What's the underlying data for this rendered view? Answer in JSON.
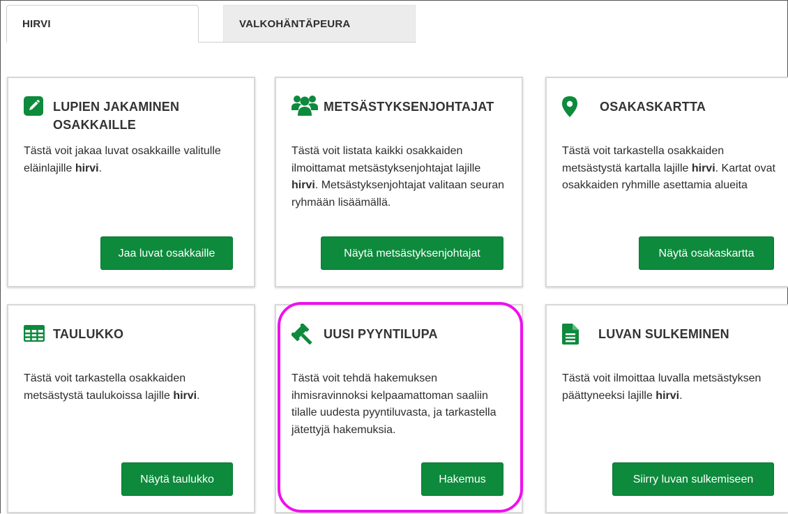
{
  "tabs": [
    {
      "label": "HIRVI",
      "active": true
    },
    {
      "label": "VALKOHÄNTÄPEURA",
      "active": false
    }
  ],
  "colors": {
    "accent_green": "#0d8a3c",
    "highlight_magenta": "#ee10ee"
  },
  "cards": [
    {
      "icon": "pencil-icon",
      "title": "LUPIEN JAKAMINEN OSAKKAILLE",
      "desc_pre": "Tästä voit jakaa luvat osakkaille valitulle eläinlajille ",
      "desc_bold": "hirvi",
      "desc_post": ".",
      "button": "Jaa luvat osakkaille"
    },
    {
      "icon": "users-icon",
      "title": "METSÄSTYKSENJOHTAJAT",
      "desc_pre": "Tästä voit listata kaikki osakkaiden ilmoittamat metsästyksenjohtajat lajille ",
      "desc_bold": "hirvi",
      "desc_post": ". Metsästyksenjohtajat valitaan seuran ryhmään lisäämällä.",
      "button": "Näytä metsästyksenjohtajat"
    },
    {
      "icon": "map-marker-icon",
      "title": "OSAKASKARTTA",
      "desc_pre": "Tästä voit tarkastella osakkaiden metsästystä kartalla lajille ",
      "desc_bold": "hirvi",
      "desc_post": ". Kartat ovat osakkaiden ryhmille asettamia alueita",
      "button": "Näytä osakaskartta"
    },
    {
      "icon": "table-icon",
      "title": "TAULUKKO",
      "desc_pre": "Tästä voit tarkastella osakkaiden metsästystä taulukoissa lajille ",
      "desc_bold": "hirvi",
      "desc_post": ".",
      "button": "Näytä taulukko"
    },
    {
      "icon": "gavel-icon",
      "title": "UUSI PYYNTILUPA",
      "desc_pre": "Tästä voit tehdä hakemuksen ihmisravinnoksi kelpaamattoman saaliin tilalle uudesta pyyntiluvasta, ja tarkastella jätettyjä hakemuksia.",
      "desc_bold": "",
      "desc_post": "",
      "button": "Hakemus"
    },
    {
      "icon": "document-icon",
      "title": "LUVAN SULKEMINEN",
      "desc_pre": "Tästä voit ilmoittaa luvalla metsästyksen päättyneeksi lajille ",
      "desc_bold": "hirvi",
      "desc_post": ".",
      "button": "Siirry luvan sulkemiseen"
    }
  ]
}
